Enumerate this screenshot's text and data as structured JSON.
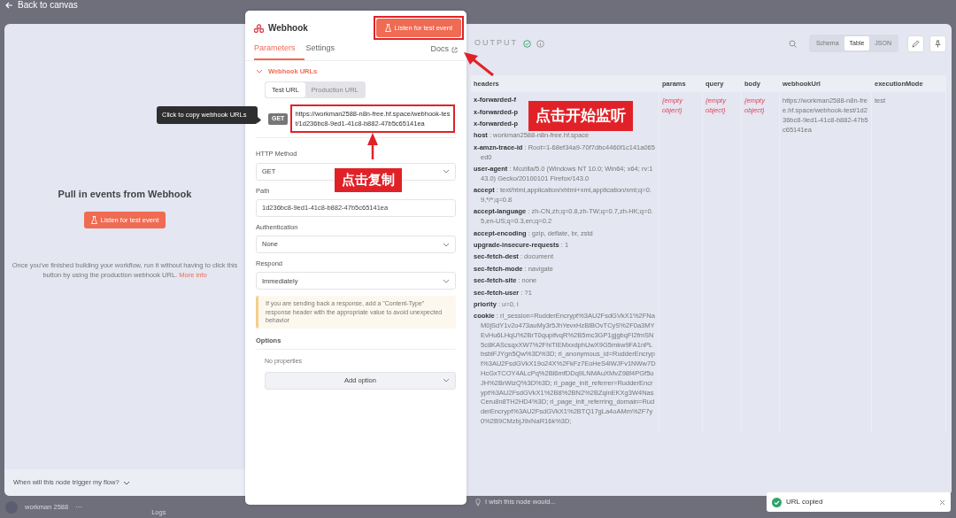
{
  "top_bar": {
    "back_label": "Back to canvas"
  },
  "input_panel": {
    "title": "Pull in events from Webhook",
    "button": "Listen for test event",
    "description": "Once you've finished building your workflow, run it without having to click this button by using the production webhook URL.",
    "link": "More info",
    "trigger_question": "When will this node trigger my flow?"
  },
  "node_panel": {
    "title": "Webhook",
    "listen_button": "Listen for test event",
    "tabs": [
      {
        "label": "Parameters",
        "selected": true
      },
      {
        "label": "Settings",
        "selected": false
      }
    ],
    "docs_link": "Docs",
    "section": {
      "title": "Webhook URLs",
      "expanded": true
    },
    "url_tabs": [
      {
        "label": "Test URL",
        "selected": true
      },
      {
        "label": "Production URL",
        "selected": false
      }
    ],
    "method_badge": "GET",
    "url": "https://workman2588-n8n-free.hf.space/webhook-test/1d236bc8-9ed1-41c8-b882-47b5c65141ea",
    "fields": [
      {
        "kind": "select",
        "label": "HTTP Method",
        "value": "GET"
      },
      {
        "kind": "input",
        "label": "Path",
        "value": "1d236bc8-9ed1-41c8-b882-47b5c65141ea"
      },
      {
        "kind": "select",
        "label": "Authentication",
        "value": "None"
      },
      {
        "kind": "select",
        "label": "Respond",
        "value": "Immediately"
      },
      {
        "kind": "notice",
        "text": "If you are sending back a response, add a \"Content-Type\" response header with the appropriate value to avoid unexpected behavior"
      }
    ],
    "options": {
      "label": "Options",
      "empty_text": "No properties",
      "add_button": "Add option"
    }
  },
  "tooltip": "Click to copy webhook URLs",
  "output_panel": {
    "title": "OUTPUT",
    "view_tabs": [
      {
        "label": "Schema",
        "selected": false
      },
      {
        "label": "Table",
        "selected": true
      },
      {
        "label": "JSON",
        "selected": false
      }
    ],
    "table": {
      "columns": [
        "headers",
        "params",
        "query",
        "body",
        "webhookUrl",
        "executionMode"
      ],
      "headers": [
        {
          "key": "x-forwarded-f"
        },
        {
          "key": "x-forwarded-p"
        },
        {
          "key": "x-forwarded-p"
        },
        {
          "key": "host",
          "value": ": workman2588-n8n-free.hf.space"
        },
        {
          "key": "x-amzn-trace-id",
          "value": ": Root=1-68ef34a9-70f7dbc4460f1c141a065ed0"
        },
        {
          "key": "user-agent",
          "value": ": Mozilla/5.0 (Windows NT 10.0; Win64; x64; rv:143.0) Gecko/20100101 Firefox/143.0"
        },
        {
          "key": "accept",
          "value": ": text/html,application/xhtml+xml,application/xml;q=0.9,*/*;q=0.8"
        },
        {
          "key": "accept-language",
          "value": ": zh-CN,zh;q=0.8,zh-TW;q=0.7,zh-HK;q=0.5,en-US;q=0.3,en;q=0.2"
        },
        {
          "key": "accept-encoding",
          "value": ": gzip, deflate, br, zstd"
        },
        {
          "key": "upgrade-insecure-requests",
          "value": ": 1"
        },
        {
          "key": "sec-fetch-dest",
          "value": ": document"
        },
        {
          "key": "sec-fetch-mode",
          "value": ": navigate"
        },
        {
          "key": "sec-fetch-site",
          "value": ": none"
        },
        {
          "key": "sec-fetch-user",
          "value": ": ?1"
        },
        {
          "key": "priority",
          "value": ": u=0, i"
        },
        {
          "key": "cookie",
          "value": ": rl_session=RudderEncrypt%3AU2FsdGVkX1%2FNaM0jSdY1v2o473auMy3r5JhYevxHzBlBOvTCyS%2F0a3MYEvHu6LHqU%2BrT0qupifvqR%2B5mc3GP1gjgbqFI2fmSN5c8KAScsqxXW7%2FhiTIEMxxdphUwX9G5mkw9FA1nPLbsblFJYgn5Qw%3D%3D; rl_anonymous_id=RudderEncrypt%3AU2FsdGVkX19o24X%2FkFz7EoHeS4iWJFv1NWw7DHcGxTCOY4ALcPq%2Bl6mfDDq9LNMAuXMvZ98f4PGf5uJH%2BrWizQ%3D%3D; rl_page_init_referrer=RudderEncrypt%3AU2FsdGVkX1%2B8%2BN2%2BZqinEKXg3W4NasCeru8n8TH2HD4%3D; rl_page_init_referring_domain=RudderEncrypt%3AU2FsdGVkX1%2BTQ17gLa4oAMm%2F7y0%2B9CMzbjJ9xNaR16k%3D;"
        }
      ],
      "params": "{empty object}",
      "query": "{empty object}",
      "body": "{empty object}",
      "webhookUrl": "https://workman2588-n8n-free.hf.space/webhook-test/1d236bc8-9ed1-41c8-b882-47b5c65141ea",
      "executionMode": "test"
    }
  },
  "bottom_bar": {
    "user": "workman 2588",
    "more": "···",
    "logs": "Logs",
    "feedback_placeholder": "I wish this node would..."
  },
  "toast": {
    "text": "URL copied"
  },
  "annotations": [
    {
      "kind": "listen",
      "text": "点击开始监听"
    },
    {
      "kind": "copy",
      "text": "点击复制"
    }
  ]
}
